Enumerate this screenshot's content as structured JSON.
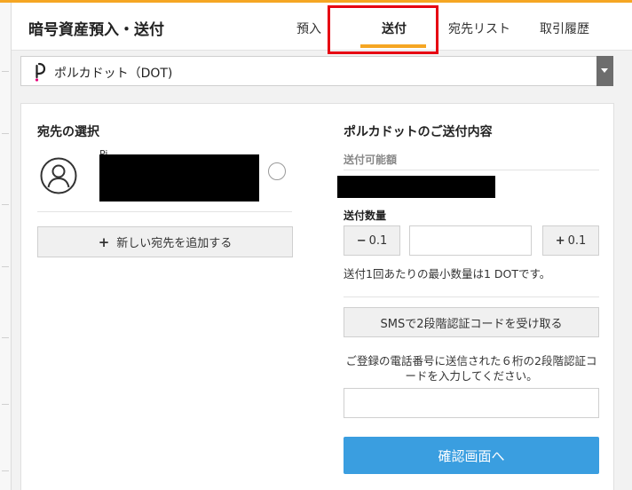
{
  "header": {
    "title": "暗号資産預入・送付",
    "tabs": [
      {
        "label": "預入"
      },
      {
        "label": "送付"
      },
      {
        "label": "宛先リスト"
      },
      {
        "label": "取引履歴"
      }
    ],
    "active_tab": "送付"
  },
  "currency_select": {
    "selected": "ポルカドット（DOT)",
    "icon": "polkadot-icon"
  },
  "recipients": {
    "title": "宛先の選択",
    "items": [
      {
        "initial": "Pi",
        "icon": "user-avatar-icon",
        "selected": false
      }
    ],
    "add_button": "新しい宛先を追加する"
  },
  "send_details": {
    "title": "ポルカドットのご送付内容",
    "available_label": "送付可能額",
    "quantity_label": "送付数量",
    "decrement_label": "0.1",
    "increment_label": "0.1",
    "quantity_value": "",
    "min_note": "送付1回あたりの最小数量は1 DOTです。",
    "sms_button": "SMSで2段階認証コードを受け取る",
    "sms_desc": "ご登録の電話番号に送信された６桁の2段階認証コードを入力してください。",
    "code_value": "",
    "confirm_button": "確認画面へ"
  },
  "colors": {
    "accent": "#f5a623",
    "primary": "#3a9ee0",
    "highlight": "#e60012",
    "polkadot": "#e6007a"
  }
}
